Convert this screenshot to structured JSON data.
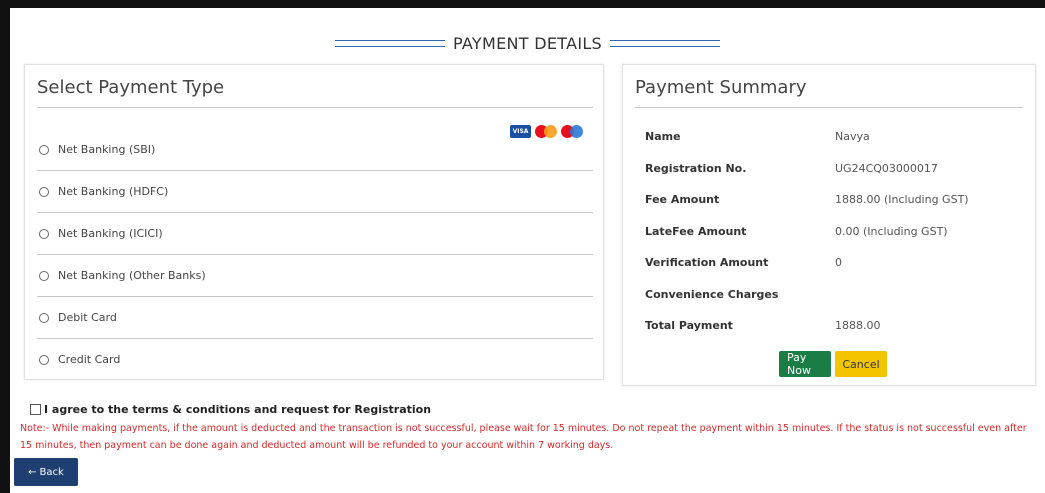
{
  "header": {
    "title": "PAYMENT DETAILS"
  },
  "payment_type": {
    "heading": "Select Payment Type",
    "card_icons": [
      "visa-icon",
      "mastercard-icon",
      "maestro-icon"
    ],
    "visa_text": "VISA",
    "options": [
      {
        "label": "Net Banking (SBI)"
      },
      {
        "label": "Net Banking (HDFC)"
      },
      {
        "label": "Net Banking (ICICI)"
      },
      {
        "label": "Net Banking (Other Banks)"
      },
      {
        "label": "Debit Card"
      },
      {
        "label": "Credit Card"
      }
    ]
  },
  "summary": {
    "heading": "Payment Summary",
    "rows": [
      {
        "label": "Name",
        "value": "Navya"
      },
      {
        "label": "Registration No.",
        "value": "UG24CQ03000017"
      },
      {
        "label": "Fee Amount",
        "value": "1888.00 (Including GST)"
      },
      {
        "label": "LateFee Amount",
        "value": "0.00 (Including GST)"
      },
      {
        "label": "Verification Amount",
        "value": "0"
      },
      {
        "label": "Convenience Charges",
        "value": ""
      },
      {
        "label": "Total Payment",
        "value": "1888.00"
      }
    ],
    "pay_now_label": "Pay Now",
    "cancel_label": "Cancel"
  },
  "agree_text": "I agree to the terms & conditions and request for Registration",
  "note": "Note:- While making payments, if the amount is deducted and the transaction is not successful, please wait for 15 minutes. Do not repeat the payment within 15 minutes. If the status is not successful even after 15 minutes, then payment can be done again and deducted amount will be refunded to your account within 7 working days.",
  "back_label": "Back",
  "colors": {
    "accent": "#2a6ab4",
    "pay_button": "#1a7d45",
    "cancel_button": "#f5c400",
    "back_button": "#1f3f73",
    "note_text": "#d62a2a"
  }
}
